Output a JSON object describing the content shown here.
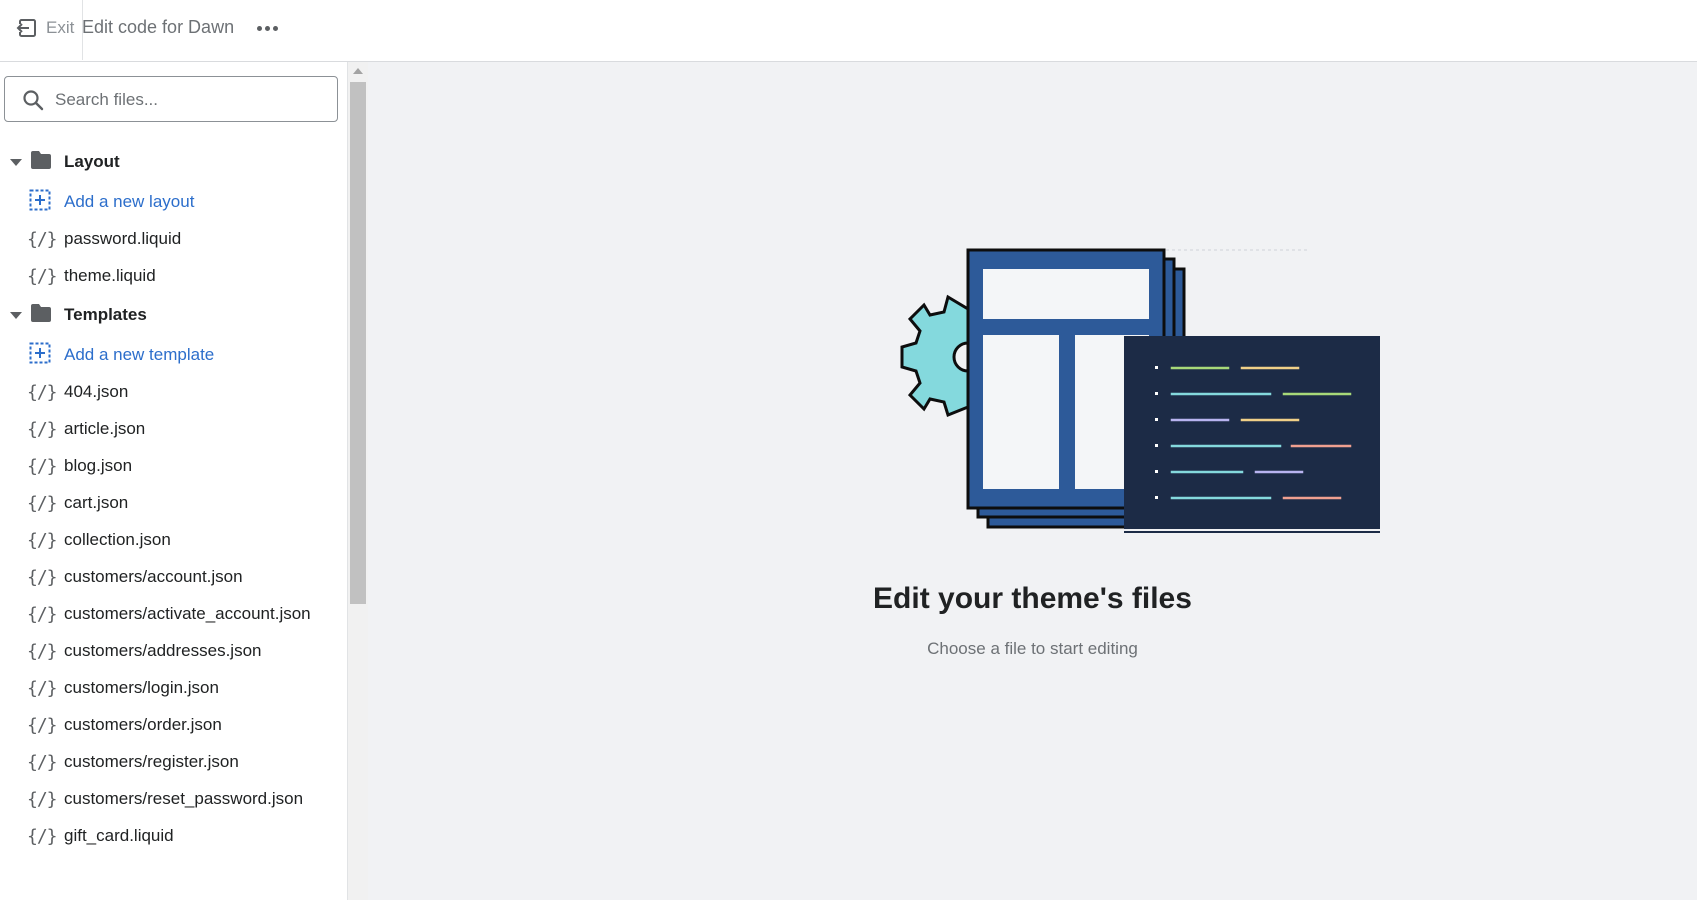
{
  "topbar": {
    "exit_label": "Exit",
    "exit_icon": "exit-arrow-icon",
    "title": "Edit code for Dawn",
    "more_icon": "horizontal-dots-icon"
  },
  "search": {
    "placeholder": "Search files...",
    "icon": "search-icon"
  },
  "sidebar": {
    "layout_folder": {
      "label": "Layout",
      "add_label": "Add a new layout",
      "files": [
        "password.liquid",
        "theme.liquid"
      ]
    },
    "templates_folder": {
      "label": "Templates",
      "add_label": "Add a new template",
      "files": [
        "404.json",
        "article.json",
        "blog.json",
        "cart.json",
        "collection.json",
        "customers/account.json",
        "customers/activate_account.json",
        "customers/addresses.json",
        "customers/login.json",
        "customers/order.json",
        "customers/register.json",
        "customers/reset_password.json",
        "gift_card.liquid"
      ]
    },
    "code_icon_glyph": "{/}"
  },
  "empty_state": {
    "title": "Edit your theme's files",
    "subtitle": "Choose a file to start editing"
  },
  "colors": {
    "link": "#2c6ecb",
    "text": "#202223",
    "muted": "#6d7175",
    "canvas": "#f1f2f4",
    "illustration_blue": "#2d5a99",
    "illustration_navy": "#1c2b46",
    "illustration_teal": "#84d9dd"
  }
}
